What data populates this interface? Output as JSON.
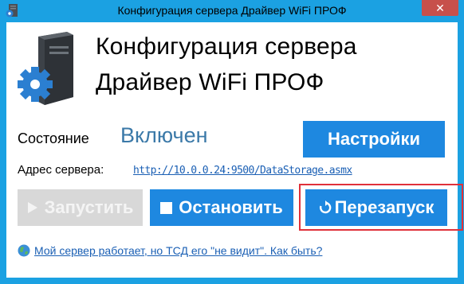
{
  "window": {
    "title": "Конфигурация сервера Драйвер WiFi ПРОФ",
    "close_label": "✕",
    "app_icon": "server-gear-icon"
  },
  "header": {
    "line1": "Конфигурация сервера",
    "line2": "Драйвер WiFi ПРОФ",
    "icon": "server-gear-icon"
  },
  "status": {
    "label": "Состояние",
    "value": "Включен"
  },
  "address": {
    "label": "Адрес сервера:",
    "url": "http://10.0.0.24:9500/DataStorage.asmx"
  },
  "buttons": {
    "settings": "Настройки",
    "start": "Запустить",
    "stop": "Остановить",
    "restart": "Перезапуск"
  },
  "help": {
    "icon": "globe-icon",
    "text": "Мой сервер работает, но ТСД его \"не видит\". Как быть?"
  },
  "colors": {
    "frame": "#1ba1e2",
    "button": "#1e88e0",
    "disabled_button": "#d8d8d8",
    "status_value": "#3b79a8",
    "highlight_border": "#e0303a",
    "close": "#c7504b"
  }
}
